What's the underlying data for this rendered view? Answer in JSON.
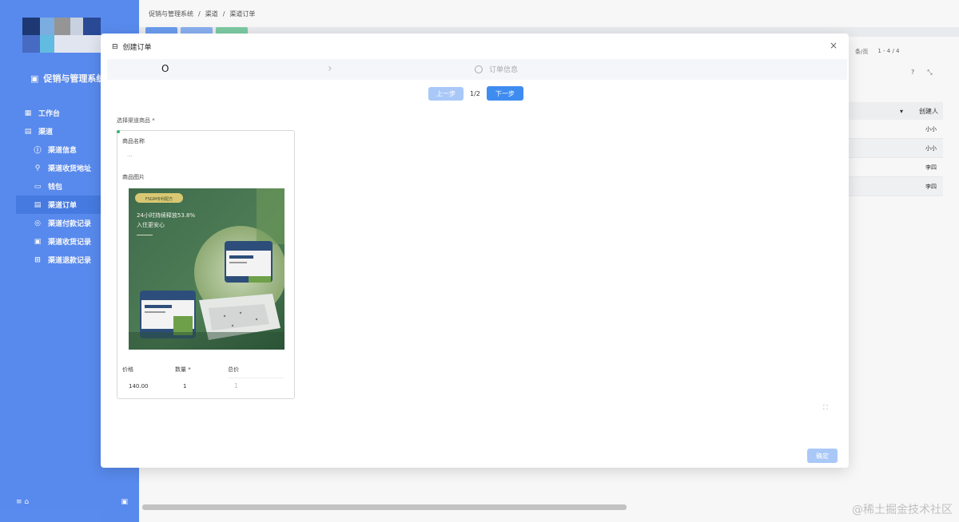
{
  "app": {
    "brand_name": "促销与管理系统",
    "watermark": "@稀土掘金技术社区"
  },
  "sidebar": {
    "items": [
      {
        "label": "工作台",
        "icon": "grid-icon",
        "level": "top"
      },
      {
        "label": "渠道",
        "icon": "store-icon",
        "level": "top"
      },
      {
        "label": "渠道信息",
        "icon": "info-icon",
        "level": "sub"
      },
      {
        "label": "渠道收货地址",
        "icon": "link-icon",
        "level": "sub"
      },
      {
        "label": "钱包",
        "icon": "wallet-icon",
        "level": "sub"
      },
      {
        "label": "渠道订单",
        "icon": "order-icon",
        "level": "sub",
        "active": true
      },
      {
        "label": "渠道付款记录",
        "icon": "payment-icon",
        "level": "sub"
      },
      {
        "label": "渠道收货记录",
        "icon": "receive-icon",
        "level": "sub"
      },
      {
        "label": "渠道退款记录",
        "icon": "refund-icon",
        "level": "sub"
      }
    ]
  },
  "breadcrumb": [
    "促销与管理系统",
    "渠道",
    "渠道订单"
  ],
  "background": {
    "pager": [
      "条/页",
      "1 - 4 / 4"
    ],
    "table_header": "创建人",
    "rows": [
      "小小",
      "小小",
      "李四",
      "李四"
    ],
    "button_colors": [
      "#6ea0f5",
      "#8fb5f7",
      "#7fd0a8"
    ]
  },
  "modal": {
    "title": "创建订单",
    "close": "×",
    "step1": "O",
    "step2": "订单信息",
    "prev_label": "上一步",
    "page_indicator": "1/2",
    "next_label": "下一步",
    "field_label": "选择渠道商品 *",
    "card": {
      "name_label": "商品名称",
      "name_value": "...",
      "image_label": "商品图片",
      "image_banner": "FSGM专利配方",
      "image_headline": "24小时持续释放53.8%",
      "image_sub": "入住更安心",
      "price_label": "价格",
      "price_value": "140.00",
      "qty_label": "数量 *",
      "qty_value": "1",
      "total_label": "总价",
      "total_value": "1"
    },
    "confirm_label": "确定"
  }
}
